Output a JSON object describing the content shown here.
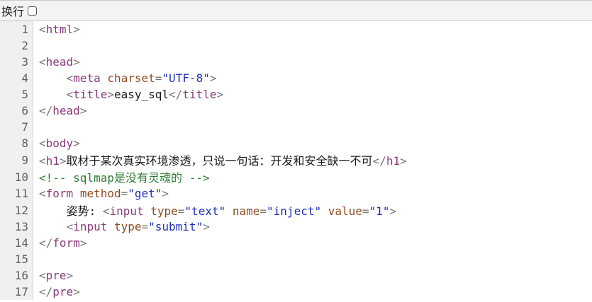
{
  "toolbar": {
    "wrap_label": "换行"
  },
  "lines": [
    {
      "n": "1",
      "parts": [
        [
          "p",
          "<"
        ],
        [
          "t",
          "html"
        ],
        [
          "p",
          ">"
        ]
      ]
    },
    {
      "n": "2",
      "parts": []
    },
    {
      "n": "3",
      "parts": [
        [
          "p",
          "<"
        ],
        [
          "t",
          "head"
        ],
        [
          "p",
          ">"
        ]
      ]
    },
    {
      "n": "4",
      "parts": [
        [
          "tx",
          "    "
        ],
        [
          "p",
          "<"
        ],
        [
          "t",
          "meta "
        ],
        [
          "a",
          "charset"
        ],
        [
          "p",
          "="
        ],
        [
          "v",
          "\"UTF-8\""
        ],
        [
          "p",
          ">"
        ]
      ]
    },
    {
      "n": "5",
      "parts": [
        [
          "tx",
          "    "
        ],
        [
          "p",
          "<"
        ],
        [
          "t",
          "title"
        ],
        [
          "p",
          ">"
        ],
        [
          "tx",
          "easy_sql"
        ],
        [
          "p",
          "</"
        ],
        [
          "t",
          "title"
        ],
        [
          "p",
          ">"
        ]
      ]
    },
    {
      "n": "6",
      "parts": [
        [
          "p",
          "</"
        ],
        [
          "t",
          "head"
        ],
        [
          "p",
          ">"
        ]
      ]
    },
    {
      "n": "7",
      "parts": []
    },
    {
      "n": "8",
      "parts": [
        [
          "p",
          "<"
        ],
        [
          "t",
          "body"
        ],
        [
          "p",
          ">"
        ]
      ]
    },
    {
      "n": "9",
      "parts": [
        [
          "p",
          "<"
        ],
        [
          "t",
          "h1"
        ],
        [
          "p",
          ">"
        ],
        [
          "tx",
          "取材于某次真实环境渗透，只说一句话：开发和安全缺一不可"
        ],
        [
          "p",
          "</"
        ],
        [
          "t",
          "h1"
        ],
        [
          "p",
          ">"
        ]
      ]
    },
    {
      "n": "10",
      "parts": [
        [
          "c",
          "<!-- sqlmap是没有灵魂的 -->"
        ]
      ]
    },
    {
      "n": "11",
      "parts": [
        [
          "p",
          "<"
        ],
        [
          "t",
          "form "
        ],
        [
          "a",
          "method"
        ],
        [
          "p",
          "="
        ],
        [
          "v",
          "\"get\""
        ],
        [
          "p",
          ">"
        ]
      ]
    },
    {
      "n": "12",
      "parts": [
        [
          "tx",
          "    姿势: "
        ],
        [
          "p",
          "<"
        ],
        [
          "t",
          "input "
        ],
        [
          "a",
          "type"
        ],
        [
          "p",
          "="
        ],
        [
          "v",
          "\"text\""
        ],
        [
          "tx",
          " "
        ],
        [
          "a",
          "name"
        ],
        [
          "p",
          "="
        ],
        [
          "v",
          "\"inject\""
        ],
        [
          "tx",
          " "
        ],
        [
          "a",
          "value"
        ],
        [
          "p",
          "="
        ],
        [
          "v",
          "\"1\""
        ],
        [
          "p",
          ">"
        ]
      ]
    },
    {
      "n": "13",
      "parts": [
        [
          "tx",
          "    "
        ],
        [
          "p",
          "<"
        ],
        [
          "t",
          "input "
        ],
        [
          "a",
          "type"
        ],
        [
          "p",
          "="
        ],
        [
          "v",
          "\"submit\""
        ],
        [
          "p",
          ">"
        ]
      ]
    },
    {
      "n": "14",
      "parts": [
        [
          "p",
          "</"
        ],
        [
          "t",
          "form"
        ],
        [
          "p",
          ">"
        ]
      ]
    },
    {
      "n": "15",
      "parts": []
    },
    {
      "n": "16",
      "parts": [
        [
          "p",
          "<"
        ],
        [
          "t",
          "pre"
        ],
        [
          "p",
          ">"
        ]
      ]
    },
    {
      "n": "17",
      "parts": [
        [
          "p",
          "</"
        ],
        [
          "t",
          "pre"
        ],
        [
          "p",
          ">"
        ]
      ]
    }
  ]
}
